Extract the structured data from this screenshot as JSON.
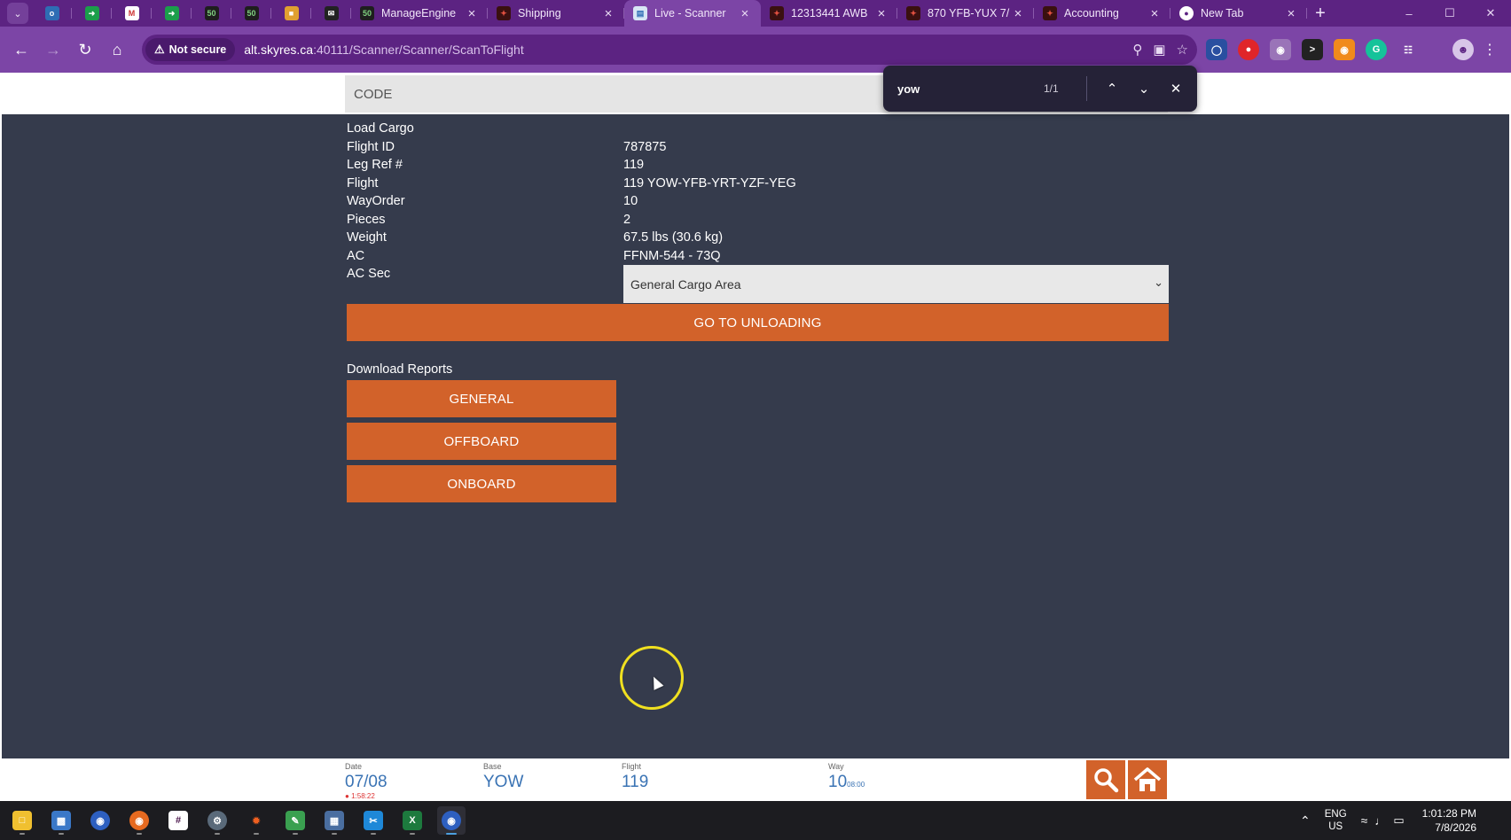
{
  "browser": {
    "tabs": [
      {
        "title": "ManageEngine",
        "icon": "manageengine-icon",
        "color": "#1b9e4b"
      },
      {
        "title": "Shipping",
        "icon": "skyres-icon",
        "color": "#c0392b"
      },
      {
        "title": "Live - Scanner",
        "icon": "scanner-icon",
        "color": "#2e6db4",
        "active": true
      },
      {
        "title": "12313441 AWB",
        "icon": "skyres-icon",
        "color": "#c0392b"
      },
      {
        "title": "870 YFB-YUX 7/",
        "icon": "skyres-icon",
        "color": "#c0392b"
      },
      {
        "title": "Accounting",
        "icon": "skyres-icon",
        "color": "#c0392b"
      },
      {
        "title": "New Tab",
        "icon": "chrome-icon",
        "color": "#ffffff"
      }
    ],
    "not_secure_label": "Not secure",
    "url_host": "alt.skyres.ca",
    "url_path": ":40111/Scanner/Scanner/ScanToFlight"
  },
  "find_bar": {
    "query": "yow",
    "count": "1/1"
  },
  "page": {
    "code_placeholder": "CODE",
    "section_title": "Load Cargo",
    "fields": [
      {
        "label": "Flight ID",
        "value": "787875"
      },
      {
        "label": "Leg Ref #",
        "value": "119"
      },
      {
        "label": "Flight",
        "value": "119 YOW-YFB-YRT-YZF-YEG"
      },
      {
        "label": "WayOrder",
        "value": "10"
      },
      {
        "label": "Pieces",
        "value": "2"
      },
      {
        "label": "Weight",
        "value": "67.5 lbs (30.6 kg)"
      },
      {
        "label": "AC",
        "value": "FFNM-544 - 73Q"
      }
    ],
    "ac_sec_label": "AC Sec",
    "ac_sec_value": "General Cargo Area",
    "unload_button": "GO TO UNLOADING",
    "reports_title": "Download Reports",
    "report_buttons": [
      "GENERAL",
      "OFFBOARD",
      "ONBOARD"
    ]
  },
  "footer": {
    "date_label": "Date",
    "date_value": "07/08",
    "date_sub": "1:58:22",
    "base_label": "Base",
    "base_value": "YOW",
    "flight_label": "Flight",
    "flight_value": "119",
    "way_label": "Way",
    "way_value": "10",
    "way_sub": "08:00"
  },
  "taskbar": {
    "lang_top": "ENG",
    "lang_bottom": "US",
    "time": "1:01:28 PM",
    "date": "7/8/2026"
  },
  "colors": {
    "chrome_dark": "#5c2382",
    "chrome_light": "#7c45a6",
    "page_bg": "#353b4c",
    "accent_orange": "#d2622a",
    "footer_blue": "#3a73b4"
  }
}
